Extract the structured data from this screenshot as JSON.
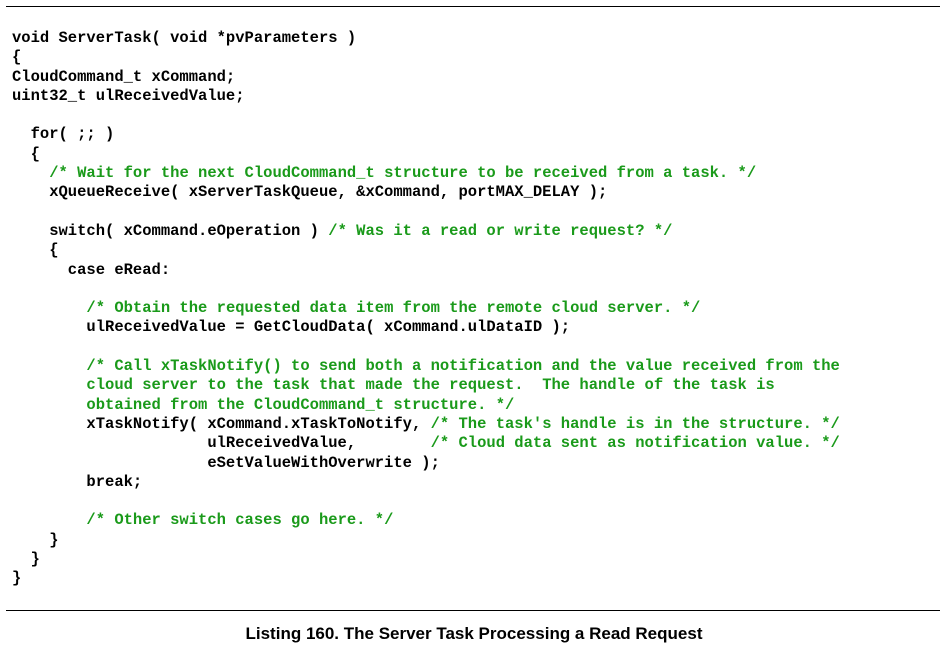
{
  "listing": {
    "lines": [
      [
        [
          "void ServerTask( void *pvParameters )",
          "c"
        ]
      ],
      [
        [
          "{",
          "c"
        ]
      ],
      [
        [
          "CloudCommand_t xCommand;",
          "c"
        ]
      ],
      [
        [
          "uint32_t ulReceivedValue;",
          "c"
        ]
      ],
      [
        [
          "",
          "c"
        ]
      ],
      [
        [
          "  for( ;; )",
          "c"
        ]
      ],
      [
        [
          "  {",
          "c"
        ]
      ],
      [
        [
          "    ",
          "c"
        ],
        [
          "/* Wait for the next CloudCommand_t structure to be received from a task. */",
          "m"
        ]
      ],
      [
        [
          "    xQueueReceive( xServerTaskQueue, &xCommand, portMAX_DELAY );",
          "c"
        ]
      ],
      [
        [
          "",
          "c"
        ]
      ],
      [
        [
          "    switch( xCommand.eOperation ) ",
          "c"
        ],
        [
          "/* Was it a read or write request? */",
          "m"
        ]
      ],
      [
        [
          "    {",
          "c"
        ]
      ],
      [
        [
          "      case eRead:",
          "c"
        ]
      ],
      [
        [
          "",
          "c"
        ]
      ],
      [
        [
          "        ",
          "c"
        ],
        [
          "/* Obtain the requested data item from the remote cloud server. */",
          "m"
        ]
      ],
      [
        [
          "        ulReceivedValue = GetCloudData( xCommand.ulDataID );",
          "c"
        ]
      ],
      [
        [
          "",
          "c"
        ]
      ],
      [
        [
          "        ",
          "c"
        ],
        [
          "/* Call xTaskNotify() to send both a notification and the value received from the",
          "m"
        ]
      ],
      [
        [
          "        ",
          "c"
        ],
        [
          "cloud server to the task that made the request.  The handle of the task is",
          "m"
        ]
      ],
      [
        [
          "        ",
          "c"
        ],
        [
          "obtained from the CloudCommand_t structure. */",
          "m"
        ]
      ],
      [
        [
          "        xTaskNotify( xCommand.xTaskToNotify, ",
          "c"
        ],
        [
          "/* The task's handle is in the structure. */",
          "m"
        ]
      ],
      [
        [
          "                     ulReceivedValue,        ",
          "c"
        ],
        [
          "/* Cloud data sent as notification value. */",
          "m"
        ]
      ],
      [
        [
          "                     eSetValueWithOverwrite );",
          "c"
        ]
      ],
      [
        [
          "        break;",
          "c"
        ]
      ],
      [
        [
          "",
          "c"
        ]
      ],
      [
        [
          "        ",
          "c"
        ],
        [
          "/* Other switch cases go here. */",
          "m"
        ]
      ],
      [
        [
          "    }",
          "c"
        ]
      ],
      [
        [
          "  }",
          "c"
        ]
      ],
      [
        [
          "}",
          "c"
        ]
      ]
    ]
  },
  "caption": "Listing 160.  The Server Task Processing a Read Request",
  "colors": {
    "code": "#000000",
    "comment": "#1a9a1a"
  }
}
